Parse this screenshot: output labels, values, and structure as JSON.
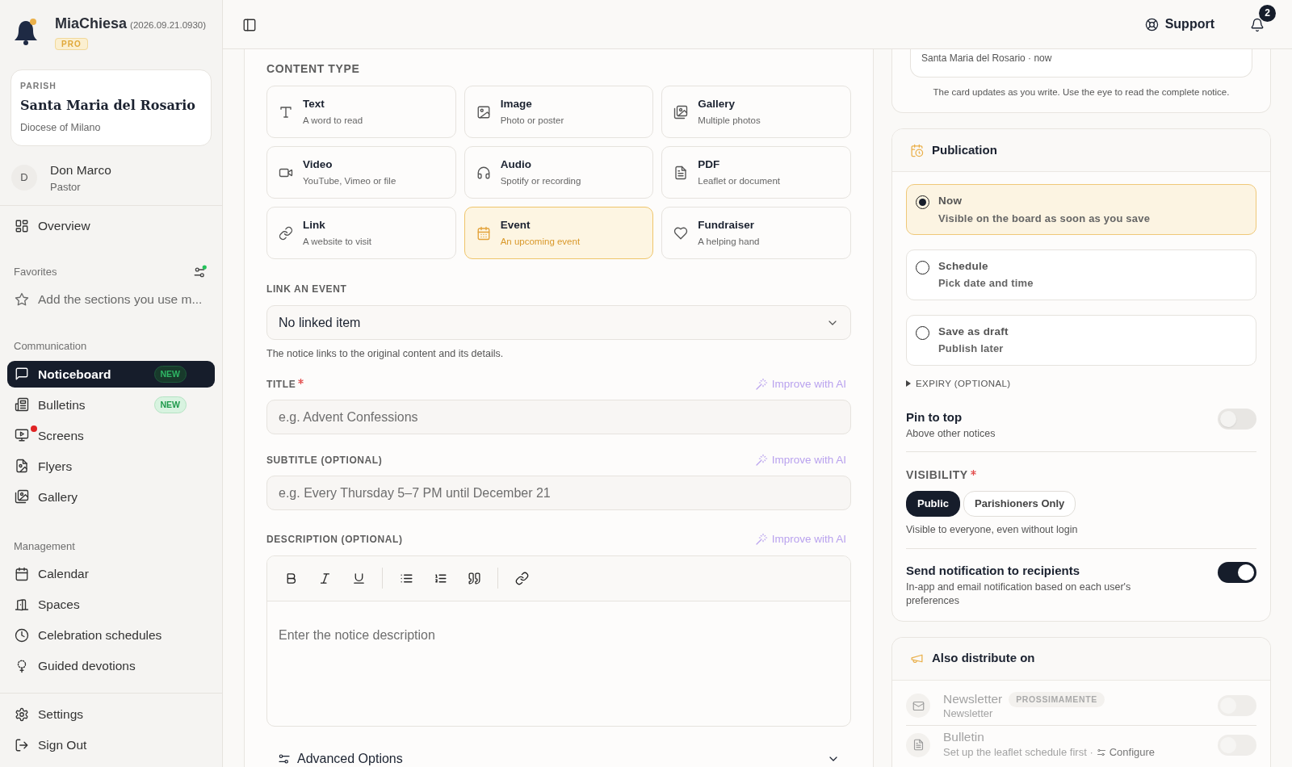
{
  "brand": {
    "name": "MiaChiesa",
    "version": "(2026.09.21.0930)",
    "plan": "PRO"
  },
  "parish": {
    "label": "PARISH",
    "name": "Santa Maria del Rosario",
    "diocese": "Diocese of Milano"
  },
  "user": {
    "initial": "D",
    "name": "Don Marco",
    "role": "Pastor"
  },
  "sidebar": {
    "overview": {
      "label": "Overview",
      "selected": false
    },
    "favorites": {
      "heading": "Favorites",
      "hint": "Add the sections you use m..."
    },
    "sections": [
      {
        "heading": "Communication",
        "items": [
          {
            "label": "Noticeboard",
            "selected": true,
            "badge": "NEW",
            "alert": false
          },
          {
            "label": "Bulletins",
            "selected": false,
            "badge": "NEW",
            "alert": false
          },
          {
            "label": "Screens",
            "selected": false,
            "alert": true
          },
          {
            "label": "Flyers",
            "selected": false,
            "alert": false
          },
          {
            "label": "Gallery",
            "selected": false,
            "alert": false
          }
        ]
      },
      {
        "heading": "Management",
        "items": [
          {
            "label": "Calendar",
            "selected": false,
            "alert": false
          },
          {
            "label": "Spaces",
            "selected": false,
            "alert": false
          },
          {
            "label": "Celebration schedules",
            "selected": false,
            "alert": false
          },
          {
            "label": "Guided devotions",
            "selected": false,
            "alert": false
          }
        ]
      }
    ],
    "footer": [
      {
        "label": "Settings",
        "selected": false
      },
      {
        "label": "Sign Out",
        "selected": false
      }
    ]
  },
  "topbar": {
    "support": "Support",
    "notifications": "2"
  },
  "form": {
    "content_type": {
      "label": "CONTENT TYPE",
      "options": [
        {
          "title": "Text",
          "subtitle": "A word to read",
          "selected": false
        },
        {
          "title": "Image",
          "subtitle": "Photo or poster",
          "selected": false
        },
        {
          "title": "Gallery",
          "subtitle": "Multiple photos",
          "selected": false
        },
        {
          "title": "Video",
          "subtitle": "YouTube, Vimeo or file",
          "selected": false
        },
        {
          "title": "Audio",
          "subtitle": "Spotify or recording",
          "selected": false
        },
        {
          "title": "PDF",
          "subtitle": "Leaflet or document",
          "selected": false
        },
        {
          "title": "Link",
          "subtitle": "A website to visit",
          "selected": false
        },
        {
          "title": "Event",
          "subtitle": "An upcoming event",
          "selected": true
        },
        {
          "title": "Fundraiser",
          "subtitle": "A helping hand",
          "selected": false
        }
      ]
    },
    "link_event": {
      "label": "LINK AN EVENT",
      "value": "No linked item",
      "help": "The notice links to the original content and its details."
    },
    "fields": [
      {
        "label": "TITLE",
        "required": true,
        "ai": "Improve with AI",
        "placeholder": "e.g. Advent Confessions"
      },
      {
        "label": "SUBTITLE (OPTIONAL)",
        "required": false,
        "ai": "Improve with AI",
        "placeholder": "e.g. Every Thursday 5–7 PM until December 21"
      }
    ],
    "description": {
      "label": "DESCRIPTION (OPTIONAL)",
      "ai": "Improve with AI",
      "placeholder": "Enter the notice description"
    },
    "advanced": {
      "label": "Advanced Options",
      "expanded": false
    }
  },
  "preview": {
    "meta": "Santa Maria del Rosario · now",
    "note": "The card updates as you write. Use the eye to read the complete notice."
  },
  "publication": {
    "title": "Publication",
    "options": [
      {
        "title": "Now",
        "subtitle": "Visible on the board as soon as you save",
        "selected": true
      },
      {
        "title": "Schedule",
        "subtitle": "Pick date and time",
        "selected": false
      },
      {
        "title": "Save as draft",
        "subtitle": "Publish later",
        "selected": false
      }
    ],
    "expiry": {
      "label": "EXPIRY (OPTIONAL)",
      "expanded": false
    },
    "pin": {
      "title": "Pin to top",
      "subtitle": "Above other notices",
      "on": false
    },
    "visibility": {
      "label": "VISIBILITY",
      "required": true,
      "options": [
        {
          "label": "Public",
          "selected": true
        },
        {
          "label": "Parishioners Only",
          "selected": false
        }
      ],
      "help": "Visible to everyone, even without login"
    },
    "notify": {
      "title": "Send notification to recipients",
      "subtitle": "In-app and email notification based on each user's preferences",
      "on": true
    }
  },
  "distribute": {
    "title": "Also distribute on",
    "channels": [
      {
        "name": "Newsletter",
        "badge": "PROSSIMAMENTE",
        "subtitle": "Newsletter",
        "disabled": true,
        "on": false
      },
      {
        "name": "Bulletin",
        "subtitle": "Set up the leaflet schedule first ·",
        "link": "Configure",
        "disabled": true,
        "on": false
      }
    ]
  }
}
